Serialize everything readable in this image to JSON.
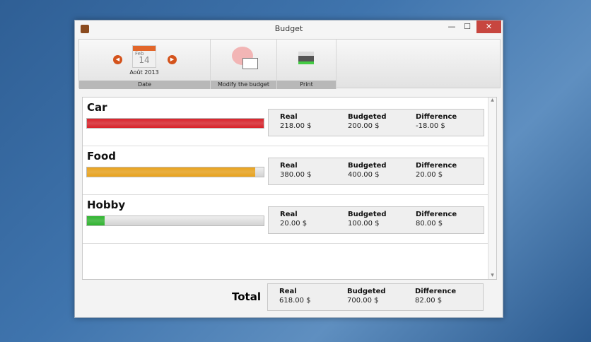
{
  "window": {
    "title": "Budget",
    "minimize": "—",
    "maximize": "☐",
    "close": "✕"
  },
  "toolbar": {
    "date_month": "Feb",
    "date_day": "14",
    "date_text": "Août 2013",
    "date_label": "Date",
    "prev": "◀",
    "next": "▶",
    "modify_label": "Modify the budget",
    "print_label": "Print"
  },
  "headers": {
    "real": "Real",
    "budgeted": "Budgeted",
    "difference": "Difference"
  },
  "categories": [
    {
      "name": "Car",
      "real": "218.00 $",
      "budgeted": "200.00 $",
      "difference": "-18.00 $",
      "fill": 1.0,
      "color": "#d9222a"
    },
    {
      "name": "Food",
      "real": "380.00 $",
      "budgeted": "400.00 $",
      "difference": "20.00 $",
      "fill": 0.95,
      "color": "#eaa31c"
    },
    {
      "name": "Hobby",
      "real": "20.00 $",
      "budgeted": "100.00 $",
      "difference": "80.00 $",
      "fill": 0.1,
      "color": "#2fb52f"
    }
  ],
  "total": {
    "label": "Total",
    "real": "618.00 $",
    "budgeted": "700.00 $",
    "difference": "82.00 $"
  }
}
